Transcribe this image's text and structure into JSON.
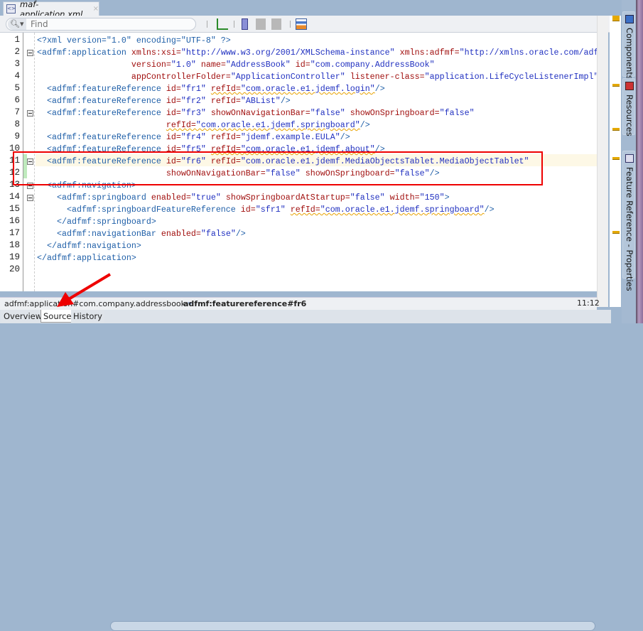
{
  "tab": {
    "title": "maf-application.xml",
    "icon": "xml-file-icon",
    "close": "×"
  },
  "toolbar": {
    "search_placeholder": "Find",
    "search_icon": "search-icon",
    "buttons": [
      "reformat-icon",
      "toggle-bookmark-icon",
      "next-bookmark-icon",
      "previous-bookmark-icon",
      "editor-options-icon"
    ]
  },
  "editor": {
    "lines": [
      [
        {
          "t": "<?xml version=\"1.0\" encoding=\"UTF-8\" ?>",
          "c": "t"
        }
      ],
      [
        {
          "t": "<adfmf:application ",
          "c": "t"
        },
        {
          "t": "xmlns:xsi=",
          "c": "a"
        },
        {
          "t": "\"http://www.w3.org/2001/XMLSchema-instance\" ",
          "c": "v"
        },
        {
          "t": "xmlns:adfmf=",
          "c": "a"
        },
        {
          "t": "\"http://xmlns.oracle.com/adf",
          "c": "v"
        }
      ],
      [
        {
          "t": "                   ",
          "c": "p"
        },
        {
          "t": "version=",
          "c": "a"
        },
        {
          "t": "\"1.0\" ",
          "c": "v"
        },
        {
          "t": "name=",
          "c": "a"
        },
        {
          "t": "\"AddressBook\" ",
          "c": "v"
        },
        {
          "t": "id=",
          "c": "a"
        },
        {
          "t": "\"com.company.AddressBook\"",
          "c": "v"
        }
      ],
      [
        {
          "t": "                   ",
          "c": "p"
        },
        {
          "t": "appControllerFolder=",
          "c": "a"
        },
        {
          "t": "\"ApplicationController\" ",
          "c": "v"
        },
        {
          "t": "listener-class=",
          "c": "a"
        },
        {
          "t": "\"application.LifeCycleListenerImpl\"",
          "c": "v"
        }
      ],
      [
        {
          "t": "  <adfmf:featureReference ",
          "c": "t"
        },
        {
          "t": "id=",
          "c": "a"
        },
        {
          "t": "\"fr1\" ",
          "c": "v"
        },
        {
          "t": "refId=",
          "c": "a w"
        },
        {
          "t": "\"com.oracle.e1.jdemf.login\"",
          "c": "v w"
        },
        {
          "t": "/>",
          "c": "t"
        }
      ],
      [
        {
          "t": "  <adfmf:featureReference ",
          "c": "t"
        },
        {
          "t": "id=",
          "c": "a"
        },
        {
          "t": "\"fr2\" ",
          "c": "v"
        },
        {
          "t": "refId=",
          "c": "a"
        },
        {
          "t": "\"ABList\"",
          "c": "v"
        },
        {
          "t": "/>",
          "c": "t"
        }
      ],
      [
        {
          "t": "  <adfmf:featureReference ",
          "c": "t"
        },
        {
          "t": "id=",
          "c": "a"
        },
        {
          "t": "\"fr3\" ",
          "c": "v"
        },
        {
          "t": "showOnNavigationBar=",
          "c": "a"
        },
        {
          "t": "\"false\" ",
          "c": "v"
        },
        {
          "t": "showOnSpringboard=",
          "c": "a"
        },
        {
          "t": "\"false\"",
          "c": "v"
        }
      ],
      [
        {
          "t": "                          ",
          "c": "p"
        },
        {
          "t": "refId=",
          "c": "a w"
        },
        {
          "t": "\"com.oracle.e1.jdemf.springboard\"",
          "c": "v w"
        },
        {
          "t": "/>",
          "c": "t"
        }
      ],
      [
        {
          "t": "  <adfmf:featureReference ",
          "c": "t"
        },
        {
          "t": "id=",
          "c": "a"
        },
        {
          "t": "\"fr4\" ",
          "c": "v"
        },
        {
          "t": "refId=",
          "c": "a"
        },
        {
          "t": "\"jdemf.example.EULA\"",
          "c": "v"
        },
        {
          "t": "/>",
          "c": "t"
        }
      ],
      [
        {
          "t": "  <adfmf:featureReference ",
          "c": "t"
        },
        {
          "t": "id=",
          "c": "a"
        },
        {
          "t": "\"fr5\" ",
          "c": "v"
        },
        {
          "t": "refId=",
          "c": "a w"
        },
        {
          "t": "\"com.oracle.e1.jdemf.about\"",
          "c": "v w"
        },
        {
          "t": "/>",
          "c": "t"
        }
      ],
      [
        {
          "t": "  <adfmf:featureReference ",
          "c": "t"
        },
        {
          "t": "id=",
          "c": "a"
        },
        {
          "t": "\"fr6\" ",
          "c": "v"
        },
        {
          "t": "refId=",
          "c": "a"
        },
        {
          "t": "\"com.oracle.e1.jdemf.MediaObjectsTablet.MediaObjectTablet\"",
          "c": "v"
        }
      ],
      [
        {
          "t": "                          ",
          "c": "p"
        },
        {
          "t": "showOnNavigationBar=",
          "c": "a"
        },
        {
          "t": "\"false\" ",
          "c": "v"
        },
        {
          "t": "showOnSpringboard=",
          "c": "a"
        },
        {
          "t": "\"false\"",
          "c": "v"
        },
        {
          "t": "/>",
          "c": "t"
        }
      ],
      [
        {
          "t": "  <adfmf:navigation>",
          "c": "t"
        }
      ],
      [
        {
          "t": "    <adfmf:springboard ",
          "c": "t"
        },
        {
          "t": "enabled=",
          "c": "a"
        },
        {
          "t": "\"true\" ",
          "c": "v"
        },
        {
          "t": "showSpringboardAtStartup=",
          "c": "a"
        },
        {
          "t": "\"false\" ",
          "c": "v"
        },
        {
          "t": "width=",
          "c": "a"
        },
        {
          "t": "\"150\"",
          "c": "v"
        },
        {
          "t": ">",
          "c": "t"
        }
      ],
      [
        {
          "t": "      <adfmf:springboardFeatureReference ",
          "c": "t"
        },
        {
          "t": "id=",
          "c": "a"
        },
        {
          "t": "\"sfr1\" ",
          "c": "v"
        },
        {
          "t": "refId=",
          "c": "a w"
        },
        {
          "t": "\"com.oracle.e1.jdemf.springboard\"",
          "c": "v w"
        },
        {
          "t": "/>",
          "c": "t"
        }
      ],
      [
        {
          "t": "    </adfmf:springboard>",
          "c": "t"
        }
      ],
      [
        {
          "t": "    <adfmf:navigationBar ",
          "c": "t"
        },
        {
          "t": "enabled=",
          "c": "a"
        },
        {
          "t": "\"false\"",
          "c": "v"
        },
        {
          "t": "/>",
          "c": "t"
        }
      ],
      [
        {
          "t": "  </adfmf:navigation>",
          "c": "t"
        }
      ],
      [
        {
          "t": "</adfmf:application>",
          "c": "t"
        }
      ],
      []
    ],
    "fold_lines": [
      2,
      7,
      11,
      13,
      14
    ],
    "current_line": 11
  },
  "breadcrumb": {
    "items": [
      "adfmf:application#com.company.addressbook",
      "adfmf:featurereference#fr6"
    ]
  },
  "cursor_position": "11:12",
  "bottom_tabs": [
    "Overview",
    "Source",
    "History"
  ],
  "active_bottom_tab": "Source",
  "side_panels": [
    {
      "label": "Components",
      "icon": "components-icon"
    },
    {
      "label": "Resources",
      "icon": "resources-icon"
    },
    {
      "label": "Feature Reference - Properties",
      "icon": "properties-icon"
    }
  ],
  "colors": {
    "tag": "#1f5fa8",
    "attr": "#a1100f",
    "value": "#2030c0",
    "annotation": "#e00000"
  }
}
